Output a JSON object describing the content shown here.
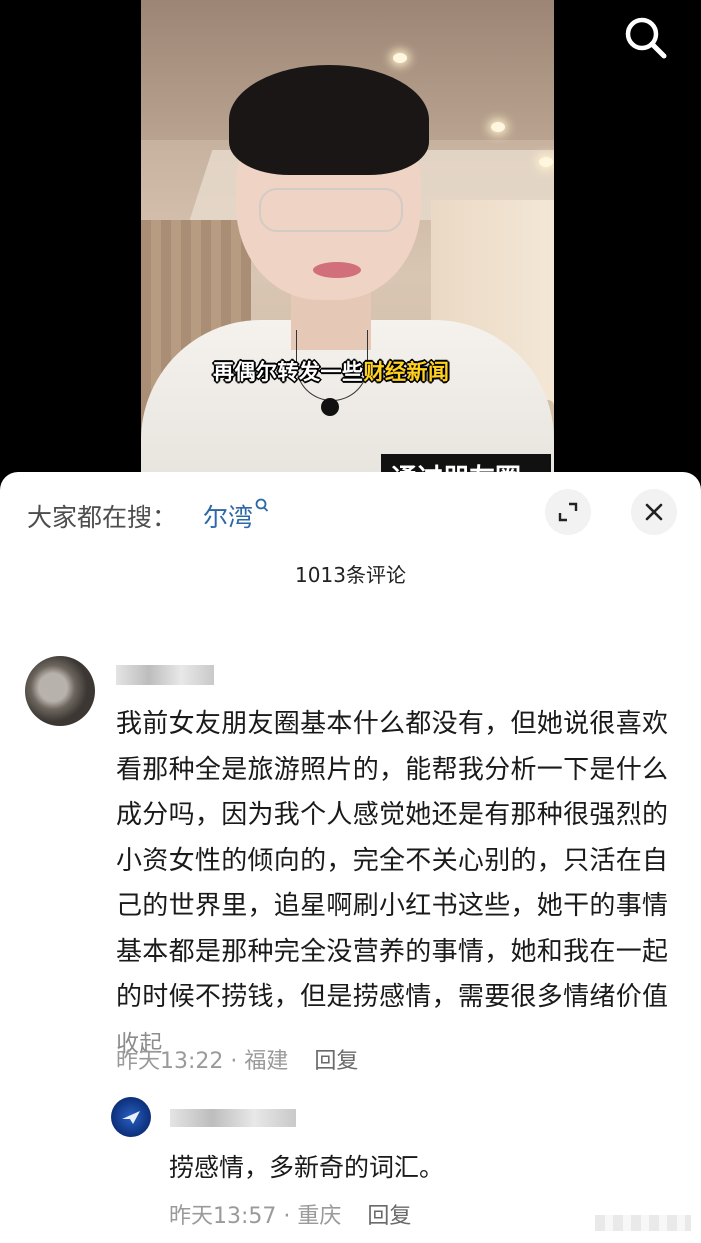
{
  "video": {
    "caption_prefix": "再偶尔转发一些",
    "caption_highlight": "财经新闻",
    "caption_cut": "通过朋友圈",
    "search_icon": "search-icon"
  },
  "sheet": {
    "hot_search_label": "大家都在搜：",
    "hot_search_term": "尔湾",
    "hot_search_icon": "magnifier-small-icon",
    "comment_count": "1013条评论",
    "expand_icon": "expand-icon",
    "close_icon": "close-icon"
  },
  "comments": [
    {
      "text": "我前女友朋友圈基本什么都没有，但她说很喜欢看那种全是旅游照片的，能帮我分析一下是什么成分吗，因为我个人感觉她还是有那种很强烈的小资女性的倾向的，完全不关心别的，只活在自己的世界里，追星啊刷小红书这些，她干的事情基本都是那种完全没营养的事情，她和我在一起的时候不捞钱，但是捞感情，需要很多情绪价值",
      "collapse": "收起",
      "time": "昨天13:22",
      "location": "福建",
      "reply_label": "回复",
      "replies": [
        {
          "text": "捞感情，多新奇的词汇。",
          "time": "昨天13:57",
          "location": "重庆",
          "reply_label": "回复"
        }
      ]
    }
  ],
  "separator": "·"
}
